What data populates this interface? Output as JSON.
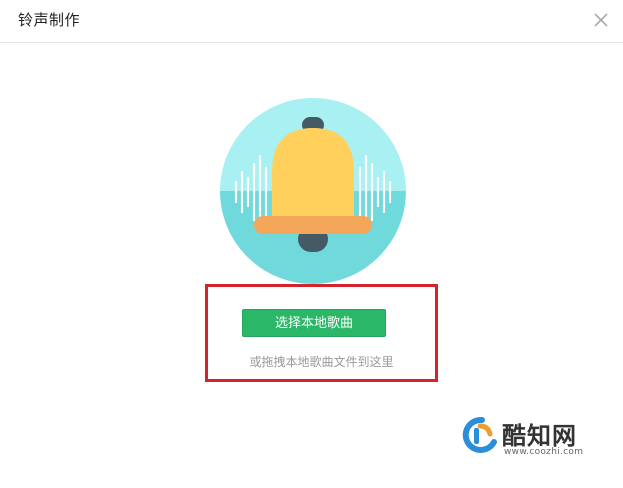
{
  "dialog": {
    "title": "铃声制作",
    "close_icon": "close-icon"
  },
  "illustration": {
    "icon": "bell-icon",
    "colors": {
      "circle_top": "#a8f0f2",
      "circle_bottom": "#6fd9dc",
      "bell_body": "#ffd15c",
      "bell_base": "#f4a75b",
      "knob": "#455a64",
      "sound_waves": "#ffffff"
    }
  },
  "actions": {
    "select_label": "选择本地歌曲",
    "drag_hint": "或拖拽本地歌曲文件到这里"
  },
  "watermark": {
    "name": "酷知网",
    "url": "www.coozhi.com"
  },
  "colors": {
    "button": "#2ab768",
    "highlight_border": "#d5232c",
    "hint_text": "#999999"
  }
}
